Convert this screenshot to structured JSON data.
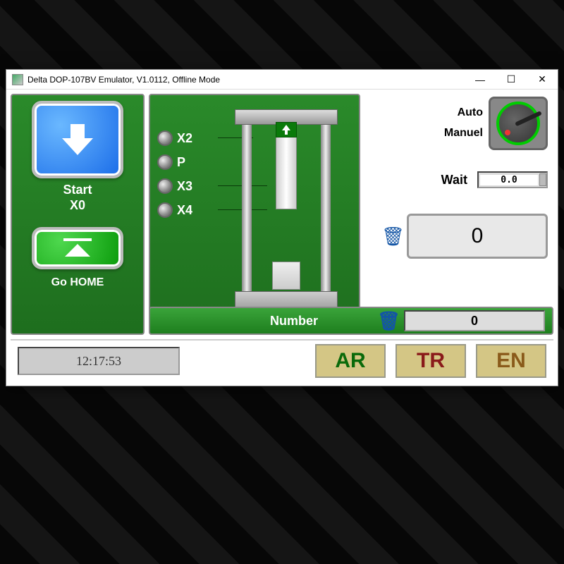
{
  "window": {
    "title": "Delta DOP-107BV Emulator, V1.0112, Offline Mode"
  },
  "left": {
    "start_label": "Start",
    "start_io": "X0",
    "gohome_label": "Go HOME"
  },
  "sensors": {
    "s1": "X2",
    "s2": "P",
    "s3": "X3",
    "s4": "X4"
  },
  "mode": {
    "auto": "Auto",
    "manual": "Manuel"
  },
  "wait": {
    "label": "Wait",
    "value": "0.0"
  },
  "counter": {
    "value": "0"
  },
  "number": {
    "label": "Number",
    "value": "0"
  },
  "clock": "12:17:53",
  "lang": {
    "ar": "AR",
    "tr": "TR",
    "en": "EN"
  }
}
